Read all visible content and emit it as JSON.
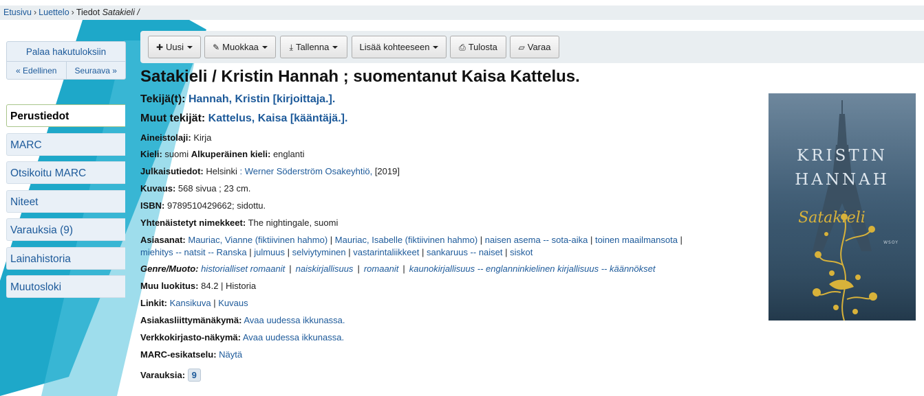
{
  "breadcrumb": {
    "home": "Etusivu",
    "catalog": "Luettelo",
    "details": "Tiedot",
    "current": "Satakieli /",
    "separator": "›"
  },
  "nav": {
    "back_to_results": "Palaa hakutuloksiin",
    "previous": "« Edellinen",
    "next": "Seuraava »"
  },
  "tabs": [
    {
      "label": "Perustiedot",
      "active": true
    },
    {
      "label": "MARC"
    },
    {
      "label": "Otsikoitu MARC"
    },
    {
      "label": "Niteet"
    },
    {
      "label": "Varauksia (9)"
    },
    {
      "label": "Lainahistoria"
    },
    {
      "label": "Muutosloki"
    }
  ],
  "toolbar": {
    "new": "Uusi",
    "edit": "Muokkaa",
    "save": "Tallenna",
    "add_to": "Lisää kohteeseen",
    "print": "Tulosta",
    "place_hold": "Varaa"
  },
  "record": {
    "title": "Satakieli / Kristin Hannah ; suomentanut Kaisa Kattelus.",
    "author_label": "Tekijä(t):",
    "author": "Hannah, Kristin [kirjoittaja.].",
    "other_authors_label": "Muut tekijät:",
    "other_author": "Kattelus, Kaisa [kääntäjä.].",
    "material_label": "Aineistolaji:",
    "material": "Kirja",
    "language_label": "Kieli:",
    "language": "suomi",
    "orig_language_label": "Alkuperäinen kieli:",
    "orig_language": "englanti",
    "publication_label": "Julkaisutiedot:",
    "publication_place": "Helsinki",
    "publisher": ": Werner Söderström Osakeyhtiö,",
    "publication_year": "[2019]",
    "description_label": "Kuvaus:",
    "description": "568 sivua ; 23 cm.",
    "isbn_label": "ISBN:",
    "isbn": "9789510429662; sidottu.",
    "uniform_title_label": "Yhtenäistetyt nimekkeet:",
    "uniform_title": "The nightingale, suomi",
    "subjects_label": "Asiasanat:",
    "subjects_line1": [
      "Mauriac, Vianne (fiktiivinen hahmo)",
      "Mauriac, Isabelle (fiktiivinen hahmo)",
      "naisen asema -- sota-aika",
      "toinen maailmansota"
    ],
    "subjects_line2": [
      "miehitys -- natsit -- Ranska",
      "julmuus",
      "selviytyminen",
      "vastarintaliikkeet",
      "sankaruus -- naiset",
      "siskot"
    ],
    "genre_label": "Genre/Muoto:",
    "genres": [
      "historialliset romaanit",
      "naiskirjallisuus",
      "romaanit",
      "kaunokirjallisuus -- englanninkielinen kirjallisuus -- käännökset"
    ],
    "classification_label": "Muu luokitus:",
    "classification": "84.2 | Historia",
    "links_label": "Linkit:",
    "link_cover": "Kansikuva",
    "link_description": "Kuvaus",
    "opac_label": "Asiakasliittymänäkymä:",
    "opac_link": "Avaa uudessa ikkunassa.",
    "web_label": "Verkkokirjasto-näkymä:",
    "web_link": "Avaa uudessa ikkunassa.",
    "marc_preview_label": "MARC-esikatselu:",
    "marc_preview_link": "Näytä",
    "holds_label": "Varauksia:",
    "holds_count": "9"
  },
  "cover": {
    "author_first": "KRISTIN",
    "author_last": "HANNAH",
    "title": "Satakieli",
    "publisher": "WSOY"
  },
  "colors": {
    "accent_teal": "#12a3c6",
    "link": "#1d5a9a",
    "toolbar_bg": "#e9eef1",
    "cover_gold": "#d8b23a"
  }
}
